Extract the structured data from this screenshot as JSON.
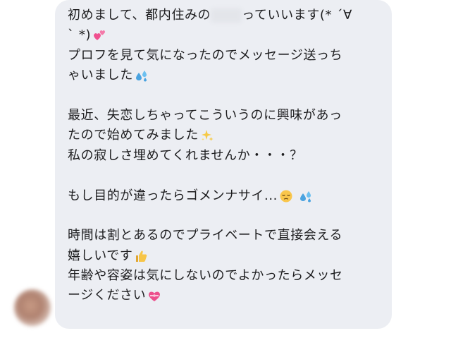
{
  "message": {
    "line1_a": "初めまして、都内住みの",
    "line1_b": "っていいます(* ´∀",
    "line2": "` *)",
    "line3": "プロフを見て気になったのでメッセージ送っち",
    "line4": "ゃいました",
    "line5": "",
    "line6": "最近、失恋しちゃってこういうのに興味があっ",
    "line7": "たので始めてみました",
    "line8": "私の寂しさ埋めてくれませんか・・・？",
    "line9": "",
    "line10": "もし目的が違ったらゴメンナサイ...",
    "line11": "",
    "line12": "時間は割とあるのでプライベートで直接会える",
    "line13": "嬉しいです",
    "line14": "年齢や容姿は気にしないのでよかったらメッセ",
    "line15": "ージください"
  },
  "icons": {
    "two_hearts": "two-hearts-icon",
    "sweat_droplets": "sweat-droplets-icon",
    "sparkles": "sparkles-icon",
    "pensive_face": "pensive-face-icon",
    "thumbs_up": "thumbs-up-icon",
    "heart_with_ribbon": "heart-with-ribbon-icon"
  },
  "colors": {
    "bubble": "#eceef3",
    "text": "#1c1c1e",
    "background": "#ffffff"
  }
}
